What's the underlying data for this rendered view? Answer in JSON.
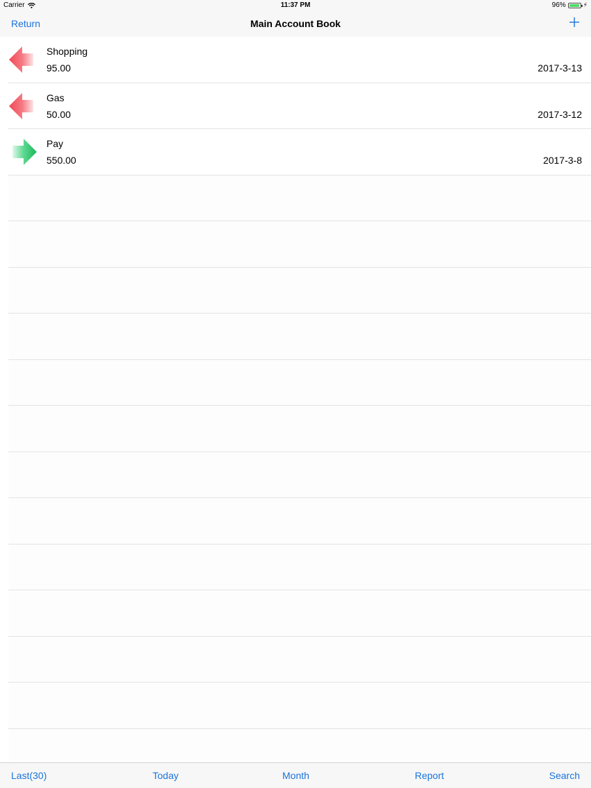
{
  "status_bar": {
    "carrier": "Carrier",
    "time": "11:37 PM",
    "battery_percent": "96%",
    "battery_level": 0.96,
    "wifi_icon": "wifi-icon",
    "charging_icon": "bolt-icon"
  },
  "nav": {
    "return_label": "Return",
    "title": "Main Account Book",
    "add_icon": "plus-icon"
  },
  "colors": {
    "accent": "#1a73d9",
    "expense_arrow": "#f04a55",
    "income_arrow": "#22c46a"
  },
  "entries": [
    {
      "name": "Shopping",
      "amount": "95.00",
      "date": "2017-3-13",
      "type": "expense",
      "icon": "red-left-arrow-icon"
    },
    {
      "name": "Gas",
      "amount": "50.00",
      "date": "2017-3-12",
      "type": "expense",
      "icon": "red-left-arrow-icon"
    },
    {
      "name": "Pay",
      "amount": "550.00",
      "date": "2017-3-8",
      "type": "income",
      "icon": "green-right-arrow-icon"
    }
  ],
  "toolbar": {
    "last_label": "Last(30)",
    "today_label": "Today",
    "month_label": "Month",
    "report_label": "Report",
    "search_label": "Search"
  }
}
